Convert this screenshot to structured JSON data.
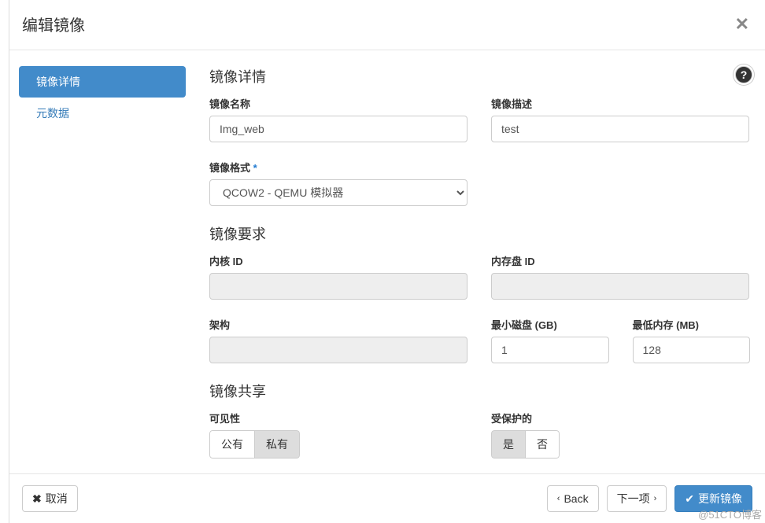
{
  "modal": {
    "title": "编辑镜像"
  },
  "sidebar": {
    "items": [
      {
        "label": "镜像详情",
        "active": true
      },
      {
        "label": "元数据",
        "active": false
      }
    ]
  },
  "sections": {
    "details": {
      "title": "镜像详情",
      "name_label": "镜像名称",
      "name_value": "Img_web",
      "desc_label": "镜像描述",
      "desc_value": "test",
      "format_label": "镜像格式",
      "format_value": "QCOW2 - QEMU 模拟器"
    },
    "requirements": {
      "title": "镜像要求",
      "kernel_label": "内核 ID",
      "kernel_value": "",
      "ramdisk_label": "内存盘 ID",
      "ramdisk_value": "",
      "arch_label": "架构",
      "arch_value": "",
      "min_disk_label": "最小磁盘 (GB)",
      "min_disk_value": "1",
      "min_ram_label": "最低内存 (MB)",
      "min_ram_value": "128"
    },
    "sharing": {
      "title": "镜像共享",
      "visibility_label": "可见性",
      "visibility_public": "公有",
      "visibility_private": "私有",
      "protected_label": "受保护的",
      "protected_yes": "是",
      "protected_no": "否"
    }
  },
  "footer": {
    "cancel": "取消",
    "back": "Back",
    "next": "下一项",
    "submit": "更新镜像"
  },
  "watermark": "@51CTO博客"
}
